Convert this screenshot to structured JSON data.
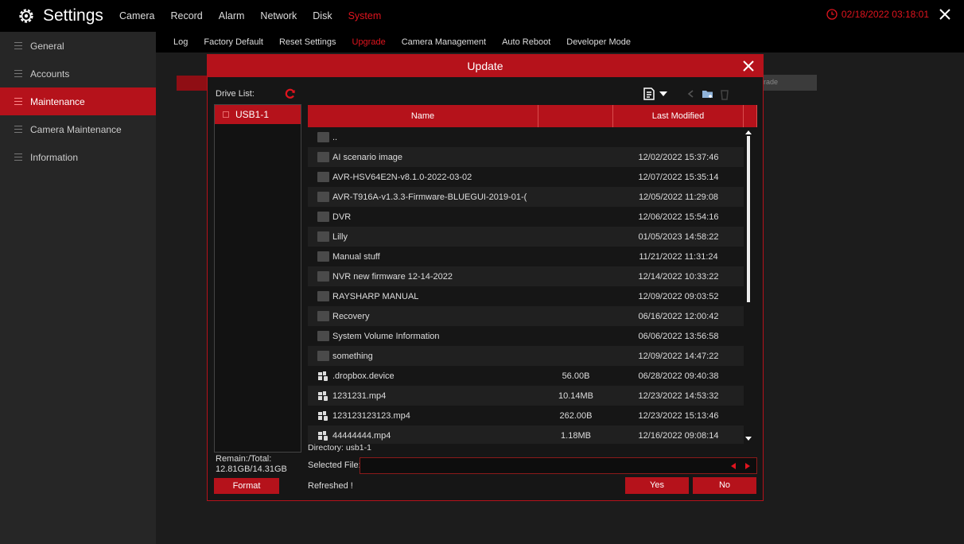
{
  "app": {
    "title": "Settings",
    "clock": "02/18/2022 03:18:01"
  },
  "top_menu": [
    "Camera",
    "Record",
    "Alarm",
    "Network",
    "Disk",
    "System"
  ],
  "sidebar": {
    "items": [
      "General",
      "Accounts",
      "Maintenance",
      "Camera Maintenance",
      "Information"
    ]
  },
  "subtabs": [
    "Log",
    "Factory Default",
    "Reset Settings",
    "Upgrade",
    "Camera Management",
    "Auto Reboot",
    "Developer Mode"
  ],
  "background": {
    "partial_label": "rade"
  },
  "dialog": {
    "title": "Update",
    "drive_list_label": "Drive List:",
    "drives": [
      "USB1-1"
    ],
    "remain_label": "Remain:/Total:",
    "remain_value": "12.81GB/14.31GB",
    "format_button": "Format",
    "columns": {
      "name": "Name",
      "size": "",
      "modified": "Last Modified"
    },
    "files": [
      {
        "name": "..",
        "size": "",
        "modified": "",
        "type": "folder"
      },
      {
        "name": "AI scenario image",
        "size": "",
        "modified": "12/02/2022 15:37:46",
        "type": "folder"
      },
      {
        "name": "AVR-HSV64E2N-v8.1.0-2022-03-02",
        "size": "",
        "modified": "12/07/2022 15:35:14",
        "type": "folder"
      },
      {
        "name": "AVR-T916A-v1.3.3-Firmware-BLUEGUI-2019-01-(",
        "size": "",
        "modified": "12/05/2022 11:29:08",
        "type": "folder"
      },
      {
        "name": "DVR",
        "size": "",
        "modified": "12/06/2022 15:54:16",
        "type": "folder"
      },
      {
        "name": "Lilly",
        "size": "",
        "modified": "01/05/2023 14:58:22",
        "type": "folder"
      },
      {
        "name": "Manual stuff",
        "size": "",
        "modified": "11/21/2022 11:31:24",
        "type": "folder"
      },
      {
        "name": "NVR new firmware 12-14-2022",
        "size": "",
        "modified": "12/14/2022 10:33:22",
        "type": "folder"
      },
      {
        "name": "RAYSHARP MANUAL",
        "size": "",
        "modified": "12/09/2022 09:03:52",
        "type": "folder"
      },
      {
        "name": "Recovery",
        "size": "",
        "modified": "06/16/2022 12:00:42",
        "type": "folder"
      },
      {
        "name": "System Volume Information",
        "size": "",
        "modified": "06/06/2022 13:56:58",
        "type": "folder"
      },
      {
        "name": "something",
        "size": "",
        "modified": "12/09/2022 14:47:22",
        "type": "folder"
      },
      {
        "name": ".dropbox.device",
        "size": "56.00B",
        "modified": "06/28/2022 09:40:38",
        "type": "file"
      },
      {
        "name": "1231231.mp4",
        "size": "10.14MB",
        "modified": "12/23/2022 14:53:32",
        "type": "file"
      },
      {
        "name": "123123123123.mp4",
        "size": "262.00B",
        "modified": "12/23/2022 15:13:46",
        "type": "file"
      },
      {
        "name": "44444444.mp4",
        "size": "1.18MB",
        "modified": "12/16/2022 09:08:14",
        "type": "file"
      }
    ],
    "directory": "Directory: usb1-1",
    "selected_file_label": "Selected File:",
    "selected_file_value": "",
    "status": "Refreshed !",
    "yes_button": "Yes",
    "no_button": "No"
  },
  "colors": {
    "accent": "#b5121b",
    "active_text": "#e0141e",
    "background": "#1c1c1c"
  }
}
